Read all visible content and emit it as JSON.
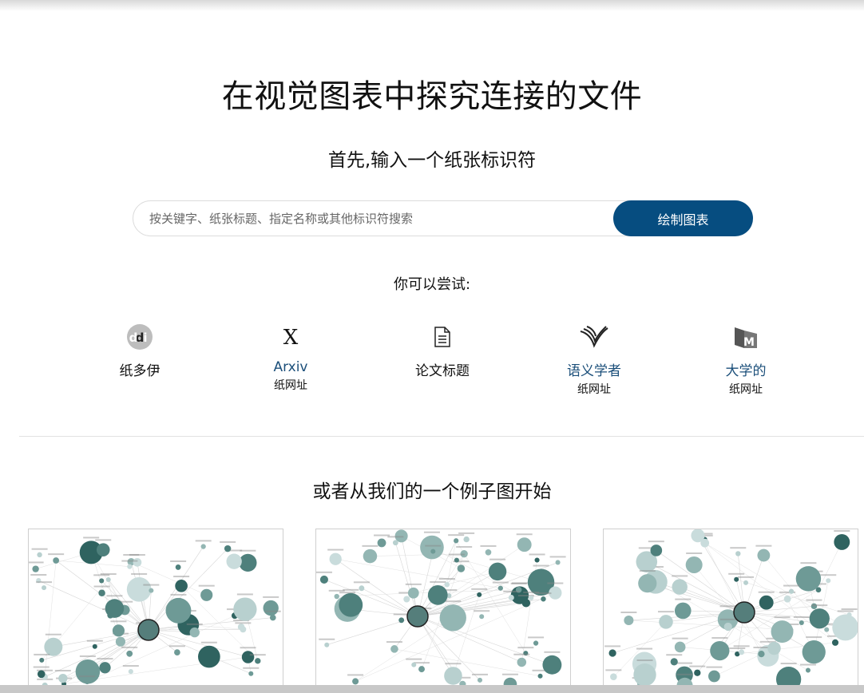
{
  "hero": {
    "title": "在视觉图表中探究连接的文件",
    "subtitle": "首先,输入一个纸张标识符"
  },
  "search": {
    "placeholder": "按关键字、纸张标题、指定名称或其他标识符搜索",
    "button_label": "绘制图表"
  },
  "try": {
    "heading": "你可以尝试:",
    "options": [
      {
        "icon": "doi-icon",
        "label": "纸多伊",
        "sub": ""
      },
      {
        "icon": "arxiv-x-icon",
        "label": "Arxiv",
        "sub": "纸网址"
      },
      {
        "icon": "document-icon",
        "label": "论文标题",
        "sub": ""
      },
      {
        "icon": "semantic-scholar-icon",
        "label": "语义学者",
        "sub": "纸网址"
      },
      {
        "icon": "microsoft-academic-icon",
        "label": "大学的",
        "sub": "纸网址"
      }
    ]
  },
  "examples": {
    "heading": "或者从我们的一个例子图开始",
    "cards": [
      "example-graph-1",
      "example-graph-2",
      "example-graph-3"
    ]
  },
  "colors": {
    "primary": "#064d80",
    "link": "#1b4f7a",
    "node_dark": "#2f6360",
    "node_light": "#c9dcdc"
  }
}
